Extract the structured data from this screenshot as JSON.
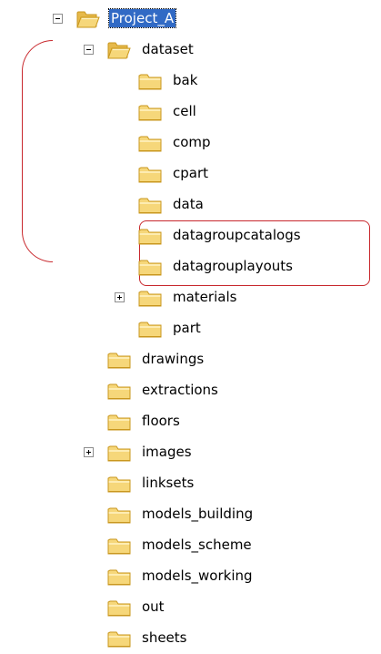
{
  "tree": {
    "nodes": [
      {
        "label": "Project_A",
        "depth": 0,
        "expander": "minus",
        "open": true,
        "selected": true
      },
      {
        "label": "dataset",
        "depth": 1,
        "expander": "minus",
        "open": true,
        "selected": false
      },
      {
        "label": "bak",
        "depth": 2,
        "expander": null,
        "open": false,
        "selected": false
      },
      {
        "label": "cell",
        "depth": 2,
        "expander": null,
        "open": false,
        "selected": false
      },
      {
        "label": "comp",
        "depth": 2,
        "expander": null,
        "open": false,
        "selected": false
      },
      {
        "label": "cpart",
        "depth": 2,
        "expander": null,
        "open": false,
        "selected": false
      },
      {
        "label": "data",
        "depth": 2,
        "expander": null,
        "open": false,
        "selected": false
      },
      {
        "label": "datagroupcatalogs",
        "depth": 2,
        "expander": null,
        "open": false,
        "selected": false
      },
      {
        "label": "datagrouplayouts",
        "depth": 2,
        "expander": null,
        "open": false,
        "selected": false
      },
      {
        "label": "materials",
        "depth": 2,
        "expander": "plus",
        "open": false,
        "selected": false
      },
      {
        "label": "part",
        "depth": 2,
        "expander": null,
        "open": false,
        "selected": false
      },
      {
        "label": "drawings",
        "depth": 1,
        "expander": null,
        "open": false,
        "selected": false
      },
      {
        "label": "extractions",
        "depth": 1,
        "expander": null,
        "open": false,
        "selected": false
      },
      {
        "label": "floors",
        "depth": 1,
        "expander": null,
        "open": false,
        "selected": false
      },
      {
        "label": "images",
        "depth": 1,
        "expander": "plus",
        "open": false,
        "selected": false
      },
      {
        "label": "linksets",
        "depth": 1,
        "expander": null,
        "open": false,
        "selected": false
      },
      {
        "label": "models_building",
        "depth": 1,
        "expander": null,
        "open": false,
        "selected": false
      },
      {
        "label": "models_scheme",
        "depth": 1,
        "expander": null,
        "open": false,
        "selected": false
      },
      {
        "label": "models_working",
        "depth": 1,
        "expander": null,
        "open": false,
        "selected": false
      },
      {
        "label": "out",
        "depth": 1,
        "expander": null,
        "open": false,
        "selected": false
      },
      {
        "label": "sheets",
        "depth": 1,
        "expander": null,
        "open": false,
        "selected": false
      }
    ]
  },
  "colors": {
    "selection": "#316ac5",
    "annotation": "#c8282d",
    "folder_fill": "#f6d77a",
    "folder_dark": "#c9971e",
    "expander_border": "#8d8d8d"
  },
  "icons": {
    "folder": "folder-icon",
    "open_folder": "open-folder-icon",
    "expand": "plus-expander-icon",
    "collapse": "minus-expander-icon"
  }
}
